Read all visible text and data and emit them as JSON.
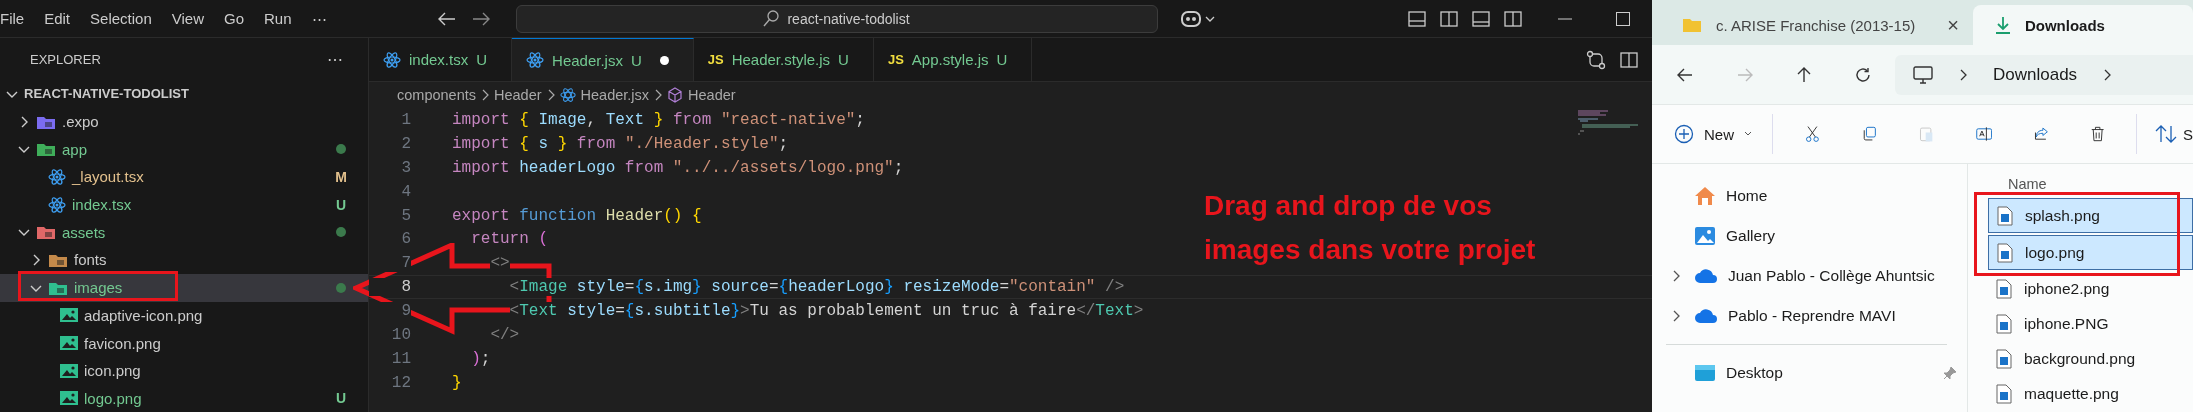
{
  "vscode": {
    "menu": [
      "File",
      "Edit",
      "Selection",
      "View",
      "Go",
      "Run",
      "⋯"
    ],
    "search": {
      "value": "react-native-todolist"
    },
    "sidebar": {
      "title": "EXPLORER",
      "more": "⋯",
      "tree": [
        {
          "label": "REACT-NATIVE-TODOLIST",
          "kind": "root",
          "expanded": true,
          "selected": false,
          "color": "#cccccc",
          "dot": false,
          "children": [
            {
              "label": ".expo",
              "kind": "expo-folder",
              "expanded": false,
              "selected": false,
              "color": "#cccccc",
              "dot": false
            },
            {
              "label": "app",
              "kind": "app-folder",
              "expanded": true,
              "selected": false,
              "color": "#73c991",
              "dot": true,
              "children": [
                {
                  "label": "_layout.tsx",
                  "kind": "react-file",
                  "selected": false,
                  "color": "#e2c08d",
                  "badge": "M",
                  "dot": false
                },
                {
                  "label": "index.tsx",
                  "kind": "react-file",
                  "selected": false,
                  "color": "#73c991",
                  "badge": "U",
                  "dot": false
                }
              ]
            },
            {
              "label": "assets",
              "kind": "assets-folder",
              "expanded": true,
              "selected": false,
              "color": "#73c991",
              "dot": true,
              "children": [
                {
                  "label": "fonts",
                  "kind": "fonts-folder",
                  "expanded": false,
                  "selected": false,
                  "color": "#cccccc",
                  "dot": false
                },
                {
                  "label": "images",
                  "kind": "images-folder",
                  "expanded": true,
                  "selected": true,
                  "color": "#73c991",
                  "dot": true,
                  "children": [
                    {
                      "label": "adaptive-icon.png",
                      "kind": "image-file",
                      "selected": false,
                      "color": "#cccccc",
                      "dot": false
                    },
                    {
                      "label": "favicon.png",
                      "kind": "image-file",
                      "selected": false,
                      "color": "#cccccc",
                      "dot": false
                    },
                    {
                      "label": "icon.png",
                      "kind": "image-file",
                      "selected": false,
                      "color": "#cccccc",
                      "dot": false
                    },
                    {
                      "label": "logo.png",
                      "kind": "image-file",
                      "selected": false,
                      "color": "#73c991",
                      "badge": "U",
                      "dot": false
                    }
                  ]
                }
              ]
            }
          ]
        }
      ]
    },
    "tabs": [
      {
        "label": "index.tsx",
        "kind": "react",
        "badge": "U",
        "selected": false,
        "dirty": false
      },
      {
        "label": "Header.jsx",
        "kind": "react",
        "badge": "U",
        "selected": true,
        "dirty": true
      },
      {
        "label": "Header.style.js",
        "kind": "js",
        "icon_text": "JS",
        "badge": "U",
        "selected": false,
        "dirty": false
      },
      {
        "label": "App.style.js",
        "kind": "js",
        "icon_text": "JS",
        "badge": "U",
        "selected": false,
        "dirty": false
      }
    ],
    "breadcrumb": [
      {
        "label": "components",
        "kind": "folder"
      },
      {
        "label": "Header",
        "kind": "folder"
      },
      {
        "label": "Header.jsx",
        "kind": "react"
      },
      {
        "label": "Header",
        "kind": "symbol"
      }
    ],
    "code": [
      {
        "number": "1",
        "current": false,
        "tokens": [
          {
            "text": "import ",
            "kind": "kw"
          },
          {
            "text": "{",
            "kind": "b1"
          },
          {
            "text": " Image",
            "kind": "var"
          },
          {
            "text": ", ",
            "kind": "p"
          },
          {
            "text": "Text",
            "kind": "var"
          },
          {
            "text": " }",
            "kind": "b1"
          },
          {
            "text": " from ",
            "kind": "kw"
          },
          {
            "text": "\"react-native\"",
            "kind": "str"
          },
          {
            "text": ";",
            "kind": "p"
          }
        ]
      },
      {
        "number": "2",
        "current": false,
        "tokens": [
          {
            "text": "import ",
            "kind": "kw"
          },
          {
            "text": "{",
            "kind": "b1"
          },
          {
            "text": " s ",
            "kind": "var"
          },
          {
            "text": "}",
            "kind": "b1"
          },
          {
            "text": " from ",
            "kind": "kw"
          },
          {
            "text": "\"./Header.style\"",
            "kind": "str"
          },
          {
            "text": ";",
            "kind": "p"
          }
        ]
      },
      {
        "number": "3",
        "current": false,
        "tokens": [
          {
            "text": "import ",
            "kind": "kw"
          },
          {
            "text": "headerLogo",
            "kind": "var"
          },
          {
            "text": " from ",
            "kind": "kw"
          },
          {
            "text": "\"../../assets/logo.png\"",
            "kind": "str"
          },
          {
            "text": ";",
            "kind": "p"
          }
        ]
      },
      {
        "number": "4",
        "current": false
      },
      {
        "number": "5",
        "current": false,
        "tokens": [
          {
            "text": "export ",
            "kind": "kw"
          },
          {
            "text": "function ",
            "kind": "storage"
          },
          {
            "text": "Header",
            "kind": "fn"
          },
          {
            "text": "() {",
            "kind": "b1"
          }
        ]
      },
      {
        "number": "6",
        "current": false,
        "tokens": [
          {
            "text": "  return ",
            "kind": "kw"
          },
          {
            "text": "(",
            "kind": "b2"
          }
        ]
      },
      {
        "number": "7",
        "current": false,
        "tokens": [
          {
            "text": "    <>",
            "kind": "grey"
          }
        ]
      },
      {
        "number": "8",
        "current": true,
        "tokens": [
          {
            "text": "      <",
            "kind": "grey"
          },
          {
            "text": "Image",
            "kind": "tag"
          },
          {
            "text": " style",
            "kind": "var"
          },
          {
            "text": "=",
            "kind": "p"
          },
          {
            "text": "{",
            "kind": "b3"
          },
          {
            "text": "s.img",
            "kind": "var"
          },
          {
            "text": "}",
            "kind": "b3"
          },
          {
            "text": " source",
            "kind": "var"
          },
          {
            "text": "=",
            "kind": "p"
          },
          {
            "text": "{",
            "kind": "b3"
          },
          {
            "text": "headerLogo",
            "kind": "var"
          },
          {
            "text": "}",
            "kind": "b3"
          },
          {
            "text": " resizeMode",
            "kind": "var"
          },
          {
            "text": "=",
            "kind": "p"
          },
          {
            "text": "\"contain\"",
            "kind": "str"
          },
          {
            "text": " />",
            "kind": "grey"
          }
        ]
      },
      {
        "number": "9",
        "current": false,
        "tokens": [
          {
            "text": "      <",
            "kind": "grey"
          },
          {
            "text": "Text",
            "kind": "tag"
          },
          {
            "text": " style",
            "kind": "var"
          },
          {
            "text": "=",
            "kind": "p"
          },
          {
            "text": "{",
            "kind": "b3"
          },
          {
            "text": "s.subtitle",
            "kind": "var"
          },
          {
            "text": "}",
            "kind": "b3"
          },
          {
            "text": ">",
            "kind": "grey"
          },
          {
            "text": "Tu as probablement un truc à faire",
            "kind": "p"
          },
          {
            "text": "</",
            "kind": "grey"
          },
          {
            "text": "Text",
            "kind": "tag"
          },
          {
            "text": ">",
            "kind": "grey"
          }
        ]
      },
      {
        "number": "10",
        "current": false,
        "tokens": [
          {
            "text": "    </>",
            "kind": "grey"
          }
        ]
      },
      {
        "number": "11",
        "current": false,
        "tokens": [
          {
            "text": "  )",
            "kind": "b2"
          },
          {
            "text": ";",
            "kind": "p"
          }
        ]
      },
      {
        "number": "12",
        "current": false,
        "tokens": [
          {
            "text": "}",
            "kind": "b1"
          }
        ]
      }
    ],
    "annotation": {
      "lines": [
        "Drag and drop de vos",
        "images dans votre projet"
      ]
    }
  },
  "file_explorer": {
    "tabs": [
      {
        "label": "c. ARISE Franchise (2013-15)",
        "kind": "folder",
        "close": "×",
        "selected": false
      },
      {
        "label": "Downloads",
        "kind": "download",
        "selected": true
      }
    ],
    "address": {
      "segments": [
        "Downloads"
      ]
    },
    "toolbar": {
      "new": "New",
      "sort": "S"
    },
    "nav": [
      {
        "label": "Home",
        "kind": "home",
        "expandable": false,
        "pinned": false
      },
      {
        "label": "Gallery",
        "kind": "gallery",
        "expandable": false,
        "pinned": false
      },
      {
        "label": "Juan Pablo - Collège Ahuntsic",
        "kind": "cloud",
        "expandable": true,
        "pinned": false
      },
      {
        "label": "Pablo - Reprendre MAVI",
        "kind": "cloud",
        "expandable": true,
        "pinned": false
      },
      {
        "label": "Desktop",
        "kind": "desktop",
        "expandable": false,
        "pinned": true
      }
    ],
    "columns": [
      "Name"
    ],
    "files": [
      {
        "name": "splash.png",
        "selected": true
      },
      {
        "name": "logo.png",
        "selected": true
      },
      {
        "name": "iphone2.png",
        "selected": false
      },
      {
        "name": "iphone.PNG",
        "selected": false
      },
      {
        "name": "background.png",
        "selected": false
      },
      {
        "name": "maquette.png",
        "selected": false
      }
    ]
  }
}
